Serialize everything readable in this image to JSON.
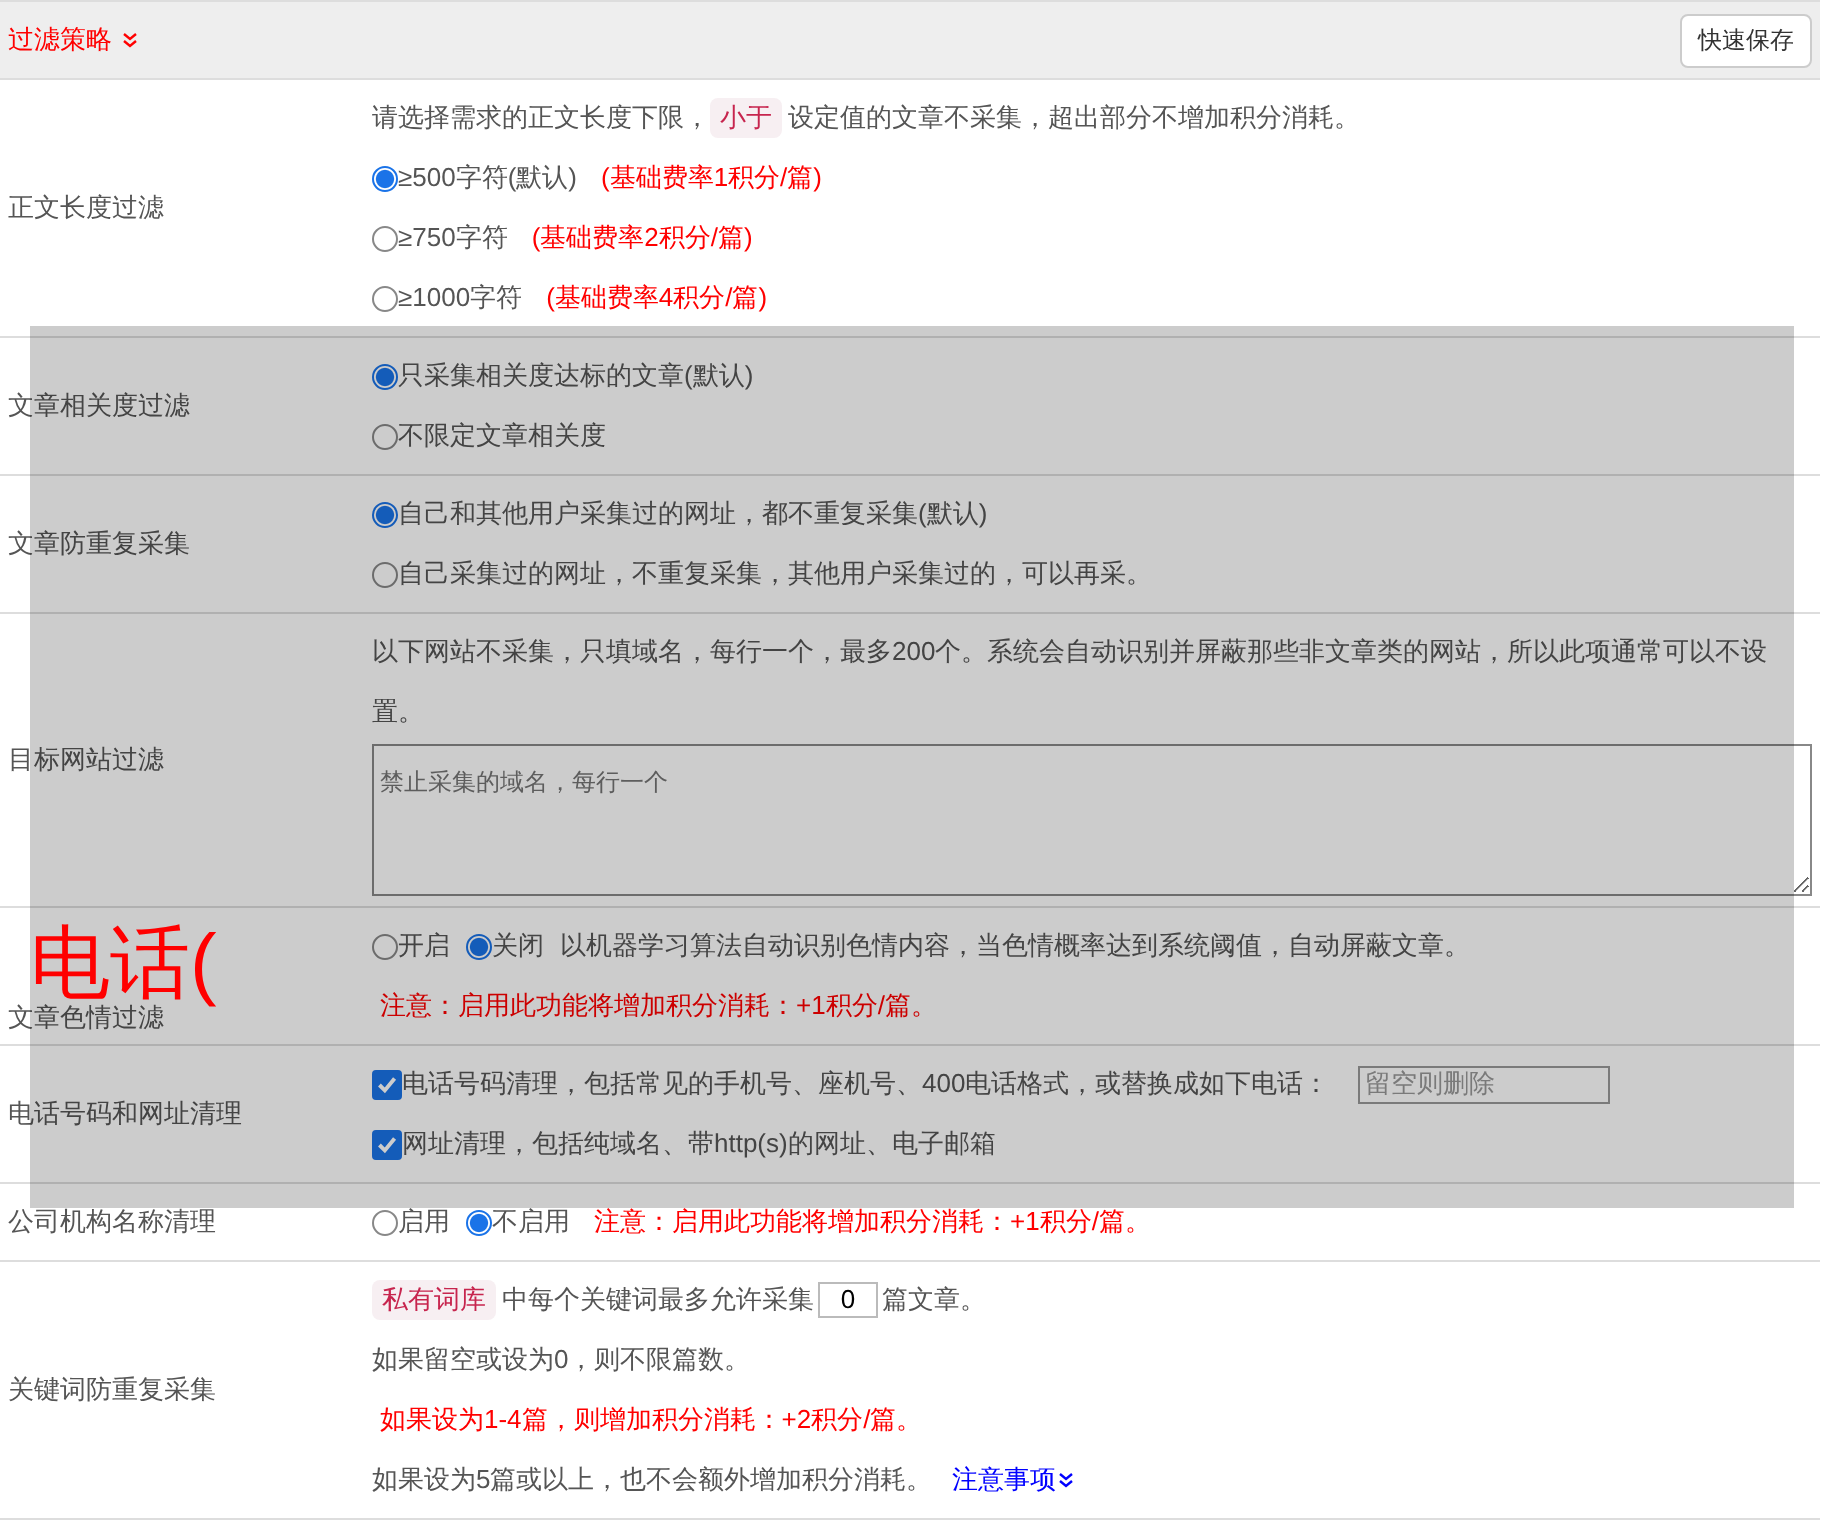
{
  "header": {
    "title": "过滤策略",
    "button": "快速保存"
  },
  "rows": [
    {
      "label": "正文长度过滤",
      "lines": [
        {
          "parts": [
            {
              "kind": "text",
              "text": "请选择需求的正文长度下限，"
            },
            {
              "kind": "tag",
              "text": "小于"
            },
            {
              "kind": "text",
              "text": " 设定值的文章不采集，超出部分不增加积分消耗。"
            }
          ]
        },
        {
          "parts": [
            {
              "kind": "radio",
              "text": "≥500字符(默认)",
              "selected": true
            },
            {
              "kind": "red",
              "text": "(基础费率1积分/篇)"
            }
          ]
        },
        {
          "parts": [
            {
              "kind": "radio",
              "text": "≥750字符",
              "selected": false
            },
            {
              "kind": "red",
              "text": "(基础费率2积分/篇)"
            }
          ]
        },
        {
          "parts": [
            {
              "kind": "radio",
              "text": "≥1000字符",
              "selected": false
            },
            {
              "kind": "red",
              "text": "(基础费率4积分/篇)"
            }
          ]
        }
      ]
    },
    {
      "label": "文章相关度过滤",
      "lines": [
        {
          "parts": [
            {
              "kind": "radio",
              "text": "只采集相关度达标的文章(默认)",
              "selected": true
            }
          ]
        },
        {
          "parts": [
            {
              "kind": "radio",
              "text": "不限定文章相关度",
              "selected": false
            }
          ]
        }
      ]
    },
    {
      "label": "文章防重复采集",
      "lines": [
        {
          "parts": [
            {
              "kind": "radio",
              "text": "自己和其他用户采集过的网址，都不重复采集(默认)",
              "selected": true
            }
          ]
        },
        {
          "parts": [
            {
              "kind": "radio",
              "text": "自己采集过的网址，不重复采集，其他用户采集过的，可以再采。",
              "selected": false
            }
          ]
        }
      ]
    },
    {
      "label": "目标网站过滤",
      "lines": [
        {
          "parts": [
            {
              "kind": "text",
              "text": "以下网站不采集，只填域名，每行一个，最多200个。系统会自动识别并屏蔽那些非文章类的网站，所以此项通常可以不设置。"
            }
          ]
        },
        {
          "parts": [
            {
              "kind": "textarea",
              "placeholder": "禁止采集的域名，每行一个"
            }
          ]
        }
      ]
    },
    {
      "label": "文章色情过滤",
      "lines": [
        {
          "parts": [
            {
              "kind": "radio",
              "text": "开启",
              "selected": false
            },
            {
              "kind": "radio",
              "text": "关闭",
              "selected": true
            },
            {
              "kind": "text",
              "text": "以机器学习算法自动识别色情内容，当色情概率达到系统阈值，自动屏蔽文章。"
            }
          ]
        },
        {
          "parts": [
            {
              "kind": "red",
              "text": "注意：启用此功能将增加积分消耗：+1积分/篇。"
            }
          ]
        }
      ]
    },
    {
      "label": "电话号码和网址清理",
      "lines": [
        {
          "parts": [
            {
              "kind": "checkbox",
              "text": "电话号码清理，包括常见的手机号、座机号、400电话格式，或替换成如下电话：",
              "checked": true
            },
            {
              "kind": "input",
              "placeholder": "留空则删除"
            }
          ]
        },
        {
          "parts": [
            {
              "kind": "checkbox",
              "text": "网址清理，包括纯域名、带http(s)的网址、电子邮箱",
              "checked": true
            }
          ]
        }
      ]
    },
    {
      "label": "公司机构名称清理",
      "lines": [
        {
          "parts": [
            {
              "kind": "radio",
              "text": "启用",
              "selected": false
            },
            {
              "kind": "radio",
              "text": "不启用",
              "selected": true
            },
            {
              "kind": "red",
              "text": "注意：启用此功能将增加积分消耗：+1积分/篇。"
            }
          ]
        }
      ]
    },
    {
      "label": "关键词防重复采集",
      "lines": [
        {
          "parts": [
            {
              "kind": "tag",
              "text": "私有词库"
            },
            {
              "kind": "text",
              "text": "中每个关键词最多允许采集"
            },
            {
              "kind": "number",
              "value": "0"
            },
            {
              "kind": "text",
              "text": "篇文章。"
            }
          ]
        },
        {
          "parts": [
            {
              "kind": "text",
              "text": "如果留空或设为0，则不限篇数。"
            }
          ]
        },
        {
          "parts": [
            {
              "kind": "red",
              "text": "如果设为1-4篇，则增加积分消耗：+2积分/篇。"
            }
          ]
        },
        {
          "parts": [
            {
              "kind": "text",
              "text": "如果设为5篇或以上，也不会额外增加积分消耗。"
            },
            {
              "kind": "link",
              "text": "注意事项"
            }
          ]
        }
      ]
    }
  ],
  "overlay": {
    "text": "电话("
  }
}
